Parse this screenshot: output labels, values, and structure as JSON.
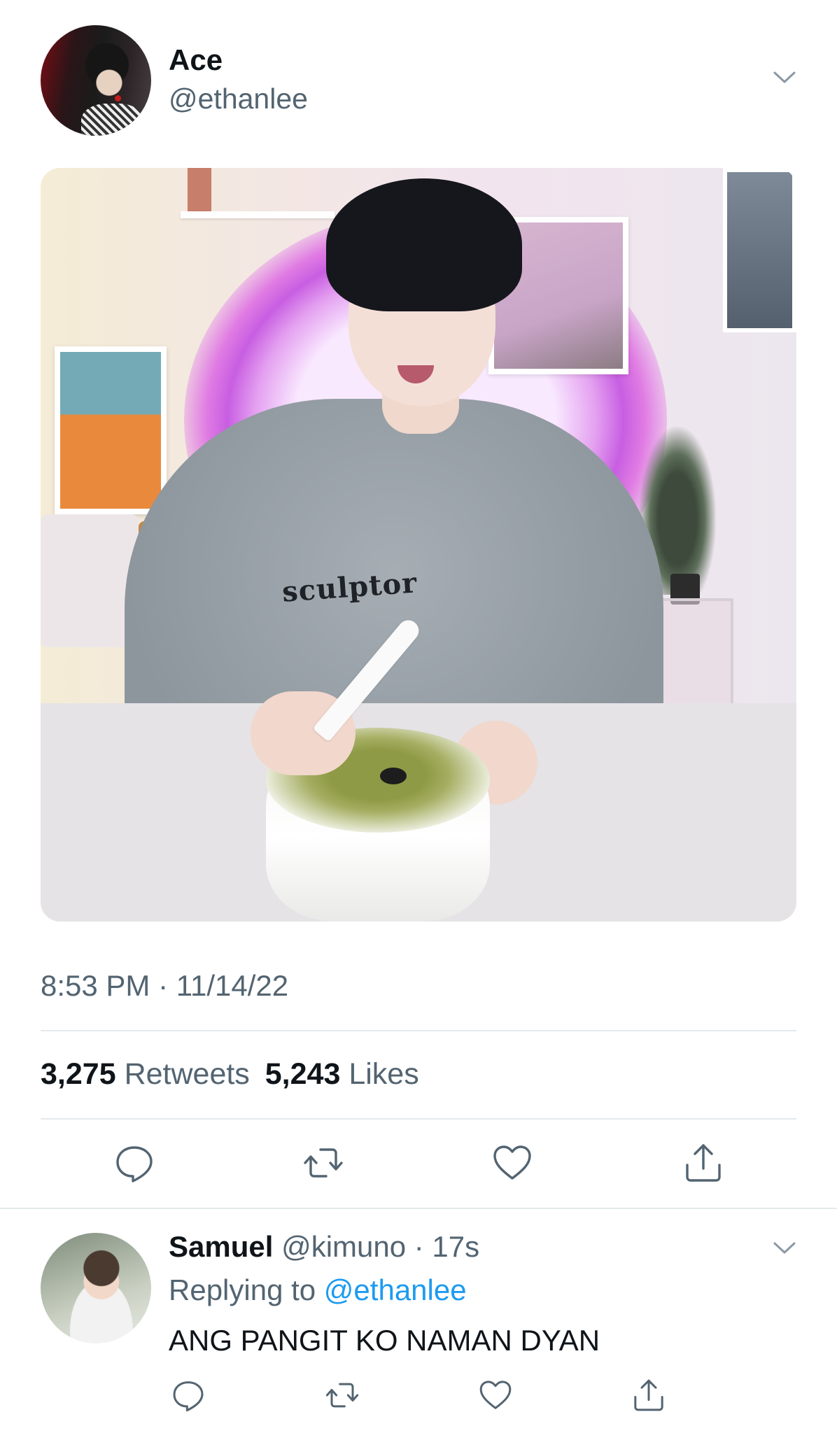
{
  "tweet": {
    "display_name": "Ace",
    "handle": "@ethanlee",
    "timestamp": "8:53 PM · 11/14/22",
    "photo_text": "sculptor",
    "stats": {
      "retweets_count": "3,275",
      "retweets_label": "Retweets",
      "likes_count": "5,243",
      "likes_label": "Likes"
    },
    "actions": [
      "reply-icon",
      "retweet-icon",
      "like-icon",
      "share-icon"
    ]
  },
  "reply": {
    "display_name": "Samuel",
    "handle_time": "@kimuno · 17s",
    "replying_prefix": "Replying to",
    "replying_mention": "@ethanlee",
    "text": "ANG PANGIT KO NAMAN DYAN",
    "actions": [
      "reply-icon",
      "retweet-icon",
      "like-icon",
      "share-icon"
    ]
  },
  "colors": {
    "text_primary": "#0f1419",
    "text_secondary": "#536471",
    "link": "#1d9bf0",
    "divider": "#e4e9ec",
    "icon": "#536471"
  }
}
